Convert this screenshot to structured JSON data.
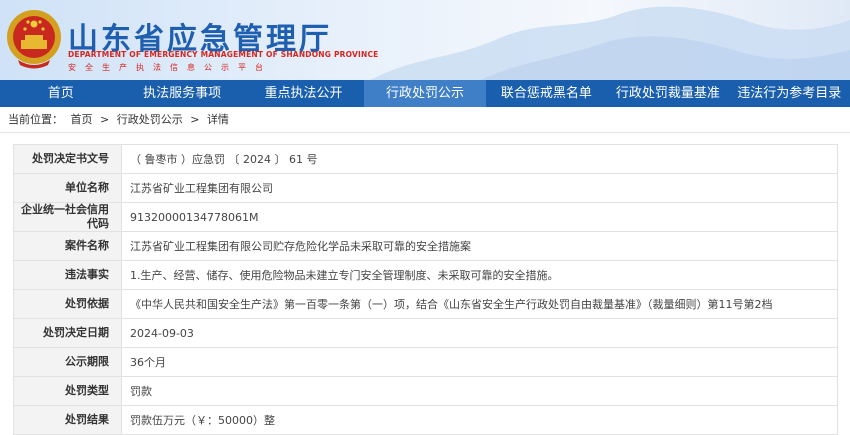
{
  "header": {
    "title": "山东省应急管理厅",
    "subtitle_en": "DEPARTMENT OF EMERGENCY MANAGEMENT OF SHANDONG PROVINCE",
    "slogan": "安全生产执法信息公示平台"
  },
  "nav": {
    "items": [
      "首页",
      "执法服务事项",
      "重点执法公开",
      "行政处罚公示",
      "联合惩戒黑名单",
      "行政处罚裁量基准",
      "违法行为参考目录"
    ],
    "active": "行政处罚公示"
  },
  "breadcrumb": {
    "prefix": "当前位置：",
    "items": [
      "首页",
      "行政处罚公示",
      "详情"
    ],
    "separator": ">"
  },
  "detail": {
    "rows": [
      {
        "label": "处罚决定书文号",
        "value": "（ 鲁枣市 ）应急罚 〔 2024 〕 61 号"
      },
      {
        "label": "单位名称",
        "value": "江苏省矿业工程集团有限公司"
      },
      {
        "label": "企业统一社会信用代码",
        "value": "91320000134778061M"
      },
      {
        "label": "案件名称",
        "value": "江苏省矿业工程集团有限公司贮存危险化学品未采取可靠的安全措施案"
      },
      {
        "label": "违法事实",
        "value": "1.生产、经营、储存、使用危险物品未建立专门安全管理制度、未采取可靠的安全措施。"
      },
      {
        "label": "处罚依据",
        "value": "《中华人民共和国安全生产法》第一百零一条第（一）项，结合《山东省安全生产行政处罚自由裁量基准》（裁量细则）第11号第2档"
      },
      {
        "label": "处罚决定日期",
        "value": "2024-09-03"
      },
      {
        "label": "公示期限",
        "value": "36个月"
      },
      {
        "label": "处罚类型",
        "value": "罚款"
      },
      {
        "label": "处罚结果",
        "value": "罚款伍万元（￥：50000）整"
      }
    ]
  },
  "colors": {
    "nav_bg": "#1a5fad",
    "nav_active": "#3f7fc7",
    "title": "#1f5fb0",
    "accent_red": "#d8251f",
    "label_bg": "#f3f3f3"
  }
}
